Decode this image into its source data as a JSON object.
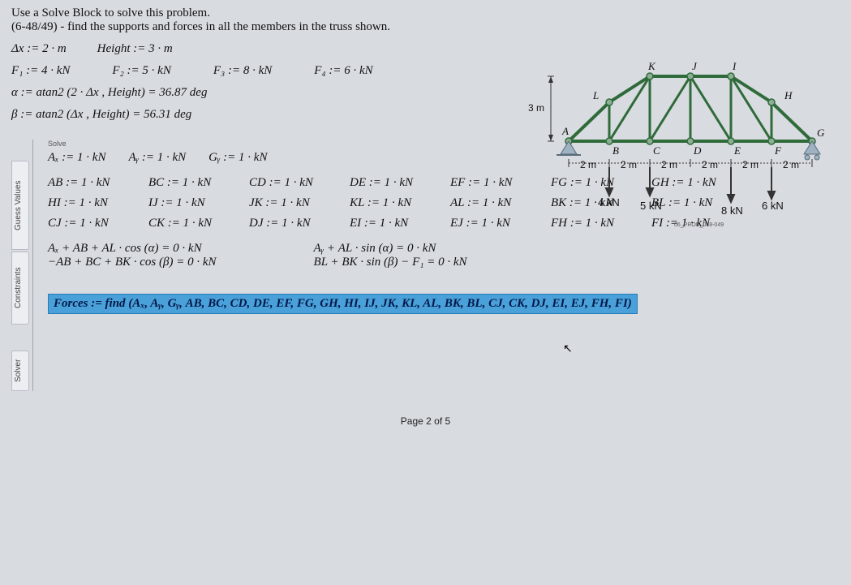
{
  "problem": {
    "title": "Use a Solve Block to solve this problem.",
    "desc": "(6-48/49) - find the supports and forces in all the members in the truss shown."
  },
  "defs": {
    "dx": "Δx := 2 · m",
    "height": "Height := 3 · m",
    "F1": "F₁ := 4 · kN",
    "F2": "F₂ := 5 · kN",
    "F3": "F₃ := 8 · kN",
    "F4": "F₄ := 6 · kN",
    "alpha": "α := atan2 (2 · Δx , Height) = 36.87  deg",
    "beta": "β := atan2 (Δx , Height) = 56.31  deg"
  },
  "tabs": {
    "solve": "Solve",
    "guess": "Guess Values",
    "constraints": "Constraints",
    "solver": "Solver"
  },
  "guess": {
    "Ax": "Aₓ := 1 · kN",
    "Ay": "Aᵧ := 1 · kN",
    "Gy": "Gᵧ := 1 · kN"
  },
  "members": {
    "AB": "AB := 1 · kN",
    "BC": "BC := 1 · kN",
    "CD": "CD := 1 · kN",
    "DE": "DE := 1 · kN",
    "EF": "EF := 1 · kN",
    "FG": "FG := 1 · kN",
    "GH": "GH := 1 · kN",
    "HI": "HI := 1 · kN",
    "IJ": "IJ := 1 · kN",
    "JK": "JK := 1 · kN",
    "KL": "KL := 1 · kN",
    "AL": "AL := 1 · kN",
    "BK": "BK := 1 · kN",
    "BL": "BL := 1 · kN",
    "CJ": "CJ := 1 · kN",
    "CK": "CK := 1 · kN",
    "DJ": "DJ := 1 · kN",
    "EI": "EI := 1 · kN",
    "EJ": "EJ := 1 · kN",
    "FH": "FH := 1 · kN",
    "FI": "FI := 1 · kN"
  },
  "constraints": {
    "c1a": "Aₓ + AB + AL · cos (α) = 0 · kN",
    "c1b": "−AB + BC + BK · cos (β) = 0 · kN",
    "c2a": "Aᵧ + AL · sin (α) = 0 · kN",
    "c2b": "BL + BK · sin (β) − F₁ = 0 · kN"
  },
  "solver": {
    "forces": "Forces := find (Aₓ, Aᵧ, Gᵧ, AB, BC, CD, DE, EF, FG, GH, HI, IJ, JK, KL, AL, BK, BL, CJ, CK, DJ, EI, EJ, FH, FI)"
  },
  "truss": {
    "dim_h": "3 m",
    "dim_w": "2 m",
    "nodes": {
      "A": "A",
      "B": "B",
      "C": "C",
      "D": "D",
      "E": "E",
      "F": "F",
      "G": "G",
      "H": "H",
      "I": "I",
      "J": "J",
      "K": "K",
      "L": "L"
    },
    "loads": {
      "B": "4 kN",
      "C": "5 kN",
      "E": "8 kN",
      "F": "6 kN"
    },
    "ref": "06_PROB_048-049"
  },
  "footer": "Page 2 of 5"
}
